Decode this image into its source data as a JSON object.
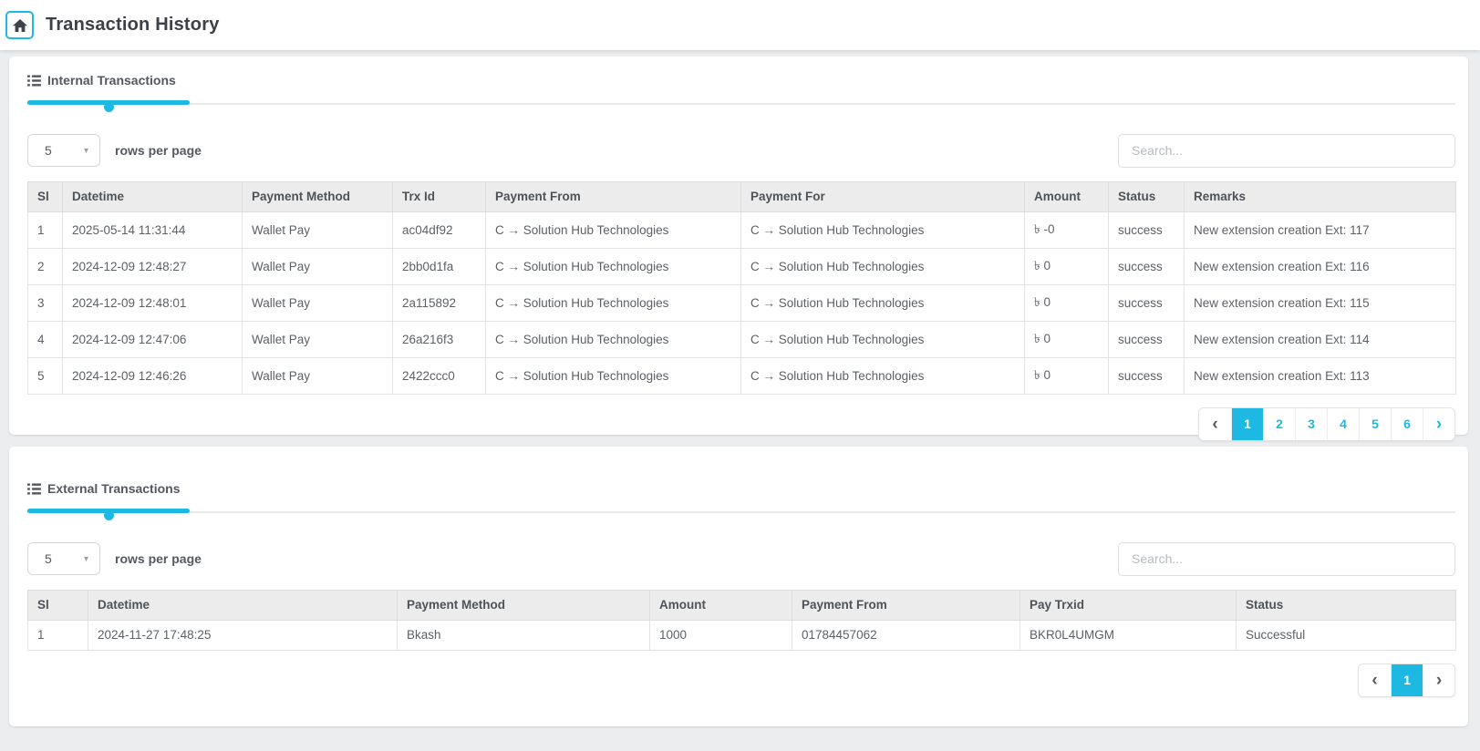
{
  "colors": {
    "accent": "#1db9e2"
  },
  "icons": {
    "home_icon": "house",
    "list_icon": "list",
    "select_caret_icon": "▾",
    "chevron_left_icon": "‹",
    "chevron_right_icon": "›"
  },
  "page": {
    "title": "Transaction History"
  },
  "internal": {
    "tab_label": "Internal Transactions",
    "rows_per_page_value": "5",
    "rows_per_page_label": "rows per page",
    "search_placeholder": "Search...",
    "table": {
      "columns": [
        "Sl",
        "Datetime",
        "Payment Method",
        "Trx Id",
        "Payment From",
        "Payment For",
        "Amount",
        "Status",
        "Remarks"
      ],
      "rows": [
        [
          "1",
          "2025-05-14 11:31:44",
          "Wallet Pay",
          "ac04df92",
          "C → Solution Hub Technologies",
          "C → Solution Hub Technologies",
          "৳ -0",
          "success",
          "New extension creation Ext: 117"
        ],
        [
          "2",
          "2024-12-09 12:48:27",
          "Wallet Pay",
          "2bb0d1fa",
          "C → Solution Hub Technologies",
          "C → Solution Hub Technologies",
          "৳ 0",
          "success",
          "New extension creation Ext: 116"
        ],
        [
          "3",
          "2024-12-09 12:48:01",
          "Wallet Pay",
          "2a115892",
          "C → Solution Hub Technologies",
          "C → Solution Hub Technologies",
          "৳ 0",
          "success",
          "New extension creation Ext: 115"
        ],
        [
          "4",
          "2024-12-09 12:47:06",
          "Wallet Pay",
          "26a216f3",
          "C → Solution Hub Technologies",
          "C → Solution Hub Technologies",
          "৳ 0",
          "success",
          "New extension creation Ext: 114"
        ],
        [
          "5",
          "2024-12-09 12:46:26",
          "Wallet Pay",
          "2422ccc0",
          "C → Solution Hub Technologies",
          "C → Solution Hub Technologies",
          "৳ 0",
          "success",
          "New extension creation Ext: 113"
        ]
      ]
    },
    "pagination": {
      "prev_enabled": false,
      "pages": [
        "1",
        "2",
        "3",
        "4",
        "5",
        "6"
      ],
      "active_page": "1",
      "next_enabled": true
    }
  },
  "external": {
    "tab_label": "External Transactions",
    "rows_per_page_value": "5",
    "rows_per_page_label": "rows per page",
    "search_placeholder": "Search...",
    "table": {
      "columns": [
        "Sl",
        "Datetime",
        "Payment Method",
        "Amount",
        "Payment From",
        "Pay Trxid",
        "Status"
      ],
      "rows": [
        [
          "1",
          "2024-11-27 17:48:25",
          "Bkash",
          "1000",
          "01784457062",
          "BKR0L4UMGM",
          "Successful"
        ]
      ]
    },
    "pagination": {
      "prev_enabled": false,
      "pages": [
        "1"
      ],
      "active_page": "1",
      "next_enabled": false
    }
  }
}
